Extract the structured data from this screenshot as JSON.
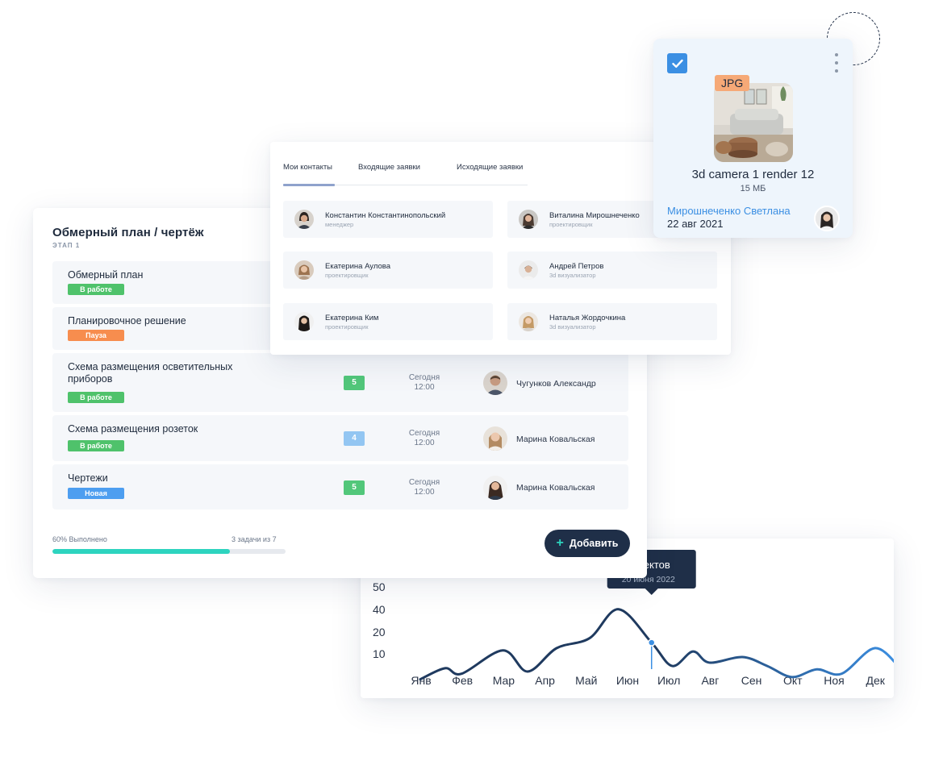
{
  "task_panel": {
    "title": "Обмерный план / чертёж",
    "stage": "ЭТАП 1",
    "tasks": [
      {
        "name": "Обмерный план",
        "status": "В работе",
        "status_color": "#4fc26b"
      },
      {
        "name": "Планировочное решение",
        "status": "Пауза",
        "status_color": "#f78d4e"
      },
      {
        "name": "Схема размещения осветительных приборов",
        "status": "В работе",
        "status_color": "#4fc26b",
        "count": "5",
        "count_color": "#52c77a",
        "due_day": "Сегодня",
        "due_time": "12:00",
        "assignee": "Чугунков Александр"
      },
      {
        "name": "Схема размещения розеток",
        "status": "В работе",
        "status_color": "#4fc26b",
        "count": "4",
        "count_color": "#93c6f2",
        "due_day": "Сегодня",
        "due_time": "12:00",
        "assignee": "Марина Ковальская"
      },
      {
        "name": "Чертежи",
        "status": "Новая",
        "status_color": "#4d9ef0",
        "count": "5",
        "count_color": "#52c77a",
        "due_day": "Сегодня",
        "due_time": "12:00",
        "assignee": "Марина Ковальская"
      }
    ],
    "progress_label": "60% Выполнено",
    "progress_value": 0.76,
    "progress_count": "3 задачи из 7",
    "progress_color": "#2dd4bf",
    "add_button": {
      "icon": "plus-icon",
      "label": "Добавить"
    }
  },
  "contacts_panel": {
    "tabs": [
      "Мои контакты",
      "Входящие заявки",
      "Исходящие заявки"
    ],
    "contacts": [
      {
        "name": "Константин Константинопольский",
        "role": "менеджер"
      },
      {
        "name": "Виталина Мирошнеченко",
        "role": "проектировщик"
      },
      {
        "name": "Екатерина Аулова",
        "role": "проектировщик"
      },
      {
        "name": "Андрей Петров",
        "role": "3d визуализатор"
      },
      {
        "name": "Екатерина Ким",
        "role": "проектировщик"
      },
      {
        "name": "Наталья Жордочкина",
        "role": "3d визуализатор"
      }
    ]
  },
  "file_card": {
    "file_type": "JPG",
    "file_name": "3d camera 1 render 12",
    "file_size": "15 МБ",
    "owner": "Мирошнеченко Светлана",
    "date": "22 авг 2021",
    "checked": true,
    "accent_color": "#3b8fe3",
    "badge_color": "#f6a977"
  },
  "chart_data": {
    "type": "line",
    "categories": [
      "Янв",
      "Фев",
      "Мар",
      "Апр",
      "Май",
      "Июн",
      "Июл",
      "Авг",
      "Сен",
      "Окт",
      "Ноя",
      "Дек"
    ],
    "yticks": [
      "10",
      "20",
      "40",
      "50"
    ],
    "series": [
      {
        "values": [
          7,
          17,
          12,
          33,
          14,
          35,
          44,
          70,
          40,
          19,
          32,
          22,
          27,
          19,
          9,
          16,
          12,
          35,
          18
        ]
      }
    ],
    "x": [
      0,
      0.6,
      1.0,
      2.0,
      2.6,
      3.3,
      4.1,
      4.8,
      5.6,
      6.1,
      6.6,
      7.0,
      7.8,
      8.4,
      9.0,
      9.6,
      10.2,
      11.0,
      11.6
    ],
    "highlight": {
      "x": 5.6,
      "y": 40
    },
    "tooltip_title": "ектов",
    "tooltip_date": "20 июня 2022",
    "line_color_start": "#1f3a5f",
    "line_color_end": "#3b8fe3"
  }
}
